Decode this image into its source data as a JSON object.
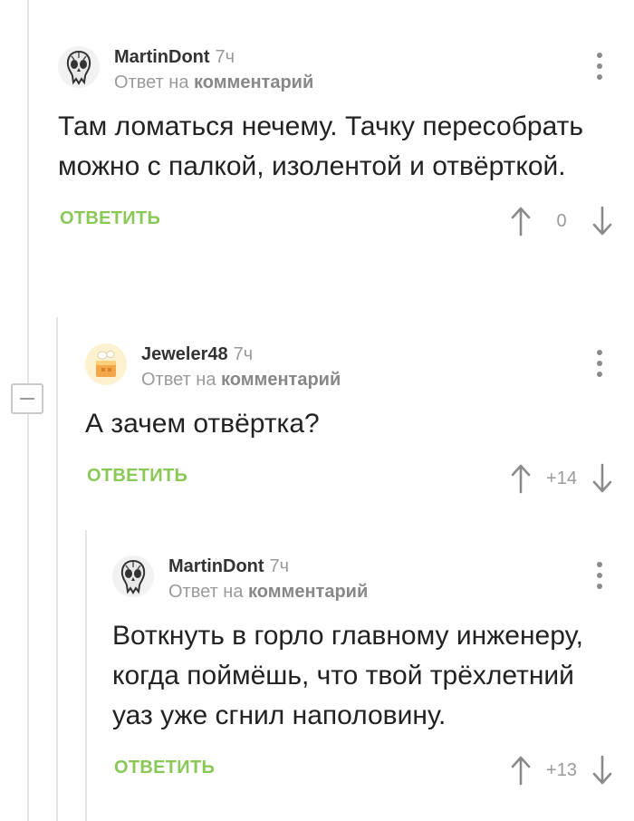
{
  "comments": [
    {
      "author": "MartinDont",
      "time": "7ч",
      "reply_prefix": "Ответ на",
      "reply_target": "комментарий",
      "text": "Там ломаться нечему. Тачку пересобрать можно с палкой, изолентой и отвёрткой.",
      "reply_label": "ОТВЕТИТЬ",
      "score": "0",
      "avatar_icon": "skull-icon"
    },
    {
      "author": "Jeweler48",
      "time": "7ч",
      "reply_prefix": "Ответ на",
      "reply_target": "комментарий",
      "text": "А зачем отвёртка?",
      "reply_label": "ОТВЕТИТЬ",
      "score": "+14",
      "avatar_icon": "cake-icon"
    },
    {
      "author": "MartinDont",
      "time": "7ч",
      "reply_prefix": "Ответ на",
      "reply_target": "комментарий",
      "text": "Воткнуть в горло главному инженеру, когда поймёшь, что твой трёхлетний уаз уже сгнил наполовину.",
      "reply_label": "ОТВЕТИТЬ",
      "score": "+13",
      "avatar_icon": "skull-icon"
    }
  ],
  "colors": {
    "accent_green": "#8ac858",
    "muted_gray": "#9a9a9a",
    "thread_line": "#e6e6e6"
  }
}
